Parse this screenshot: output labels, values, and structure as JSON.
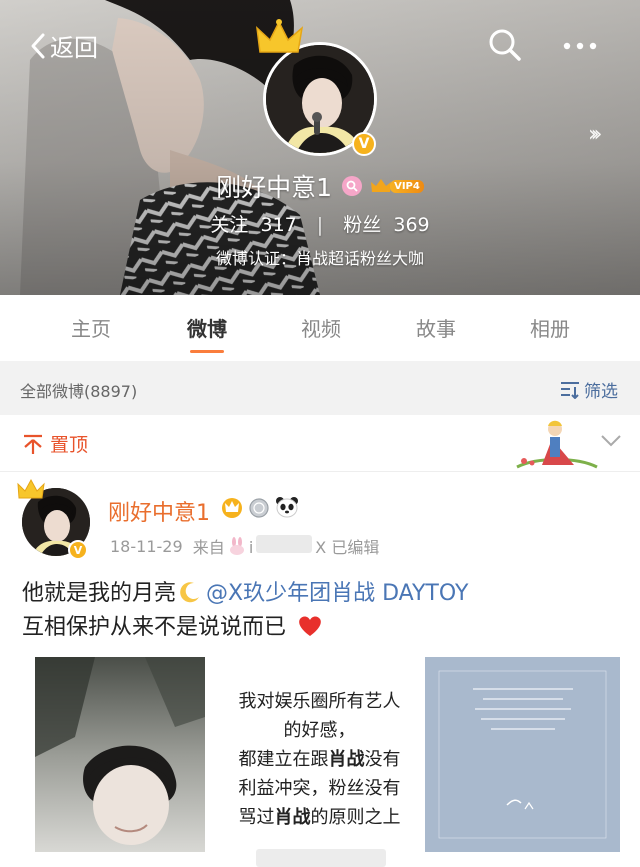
{
  "header": {
    "back_label": "返回",
    "username": "刚好中意1",
    "vip_label": "VIP4",
    "following_label": "关注",
    "following_count": "317",
    "stats_separator": "|",
    "followers_label": "粉丝",
    "followers_count": "369",
    "verification": "微博认证：肖战超话粉丝大咖"
  },
  "tabs": [
    "主页",
    "微博",
    "视频",
    "故事",
    "相册"
  ],
  "active_tab": "微博",
  "filter": {
    "count_label": "全部微博(8897)",
    "filter_label": "筛选"
  },
  "pinned": {
    "label": "置顶"
  },
  "post": {
    "author": "刚好中意1",
    "date": "18-11-29",
    "source_prefix": "来自",
    "source_suffix": "X",
    "edited": "已编辑",
    "line1_text": "他就是我的月亮",
    "line1_mention": "@X玖少年团肖战 DAYTOY",
    "line2_text": "互相保护从来不是说说而已",
    "image2_lines": [
      "我对娱乐圈所有艺人",
      "的好感，",
      "都建立在跟",
      "肖战",
      "没有",
      "利益冲突，粉丝没有",
      "骂过",
      "肖战",
      "的原则之上"
    ]
  },
  "colors": {
    "accent_orange": "#fa7d3c",
    "pin_red": "#e8532b",
    "link_blue": "#4a76b5",
    "name_orange": "#e96e2d"
  }
}
